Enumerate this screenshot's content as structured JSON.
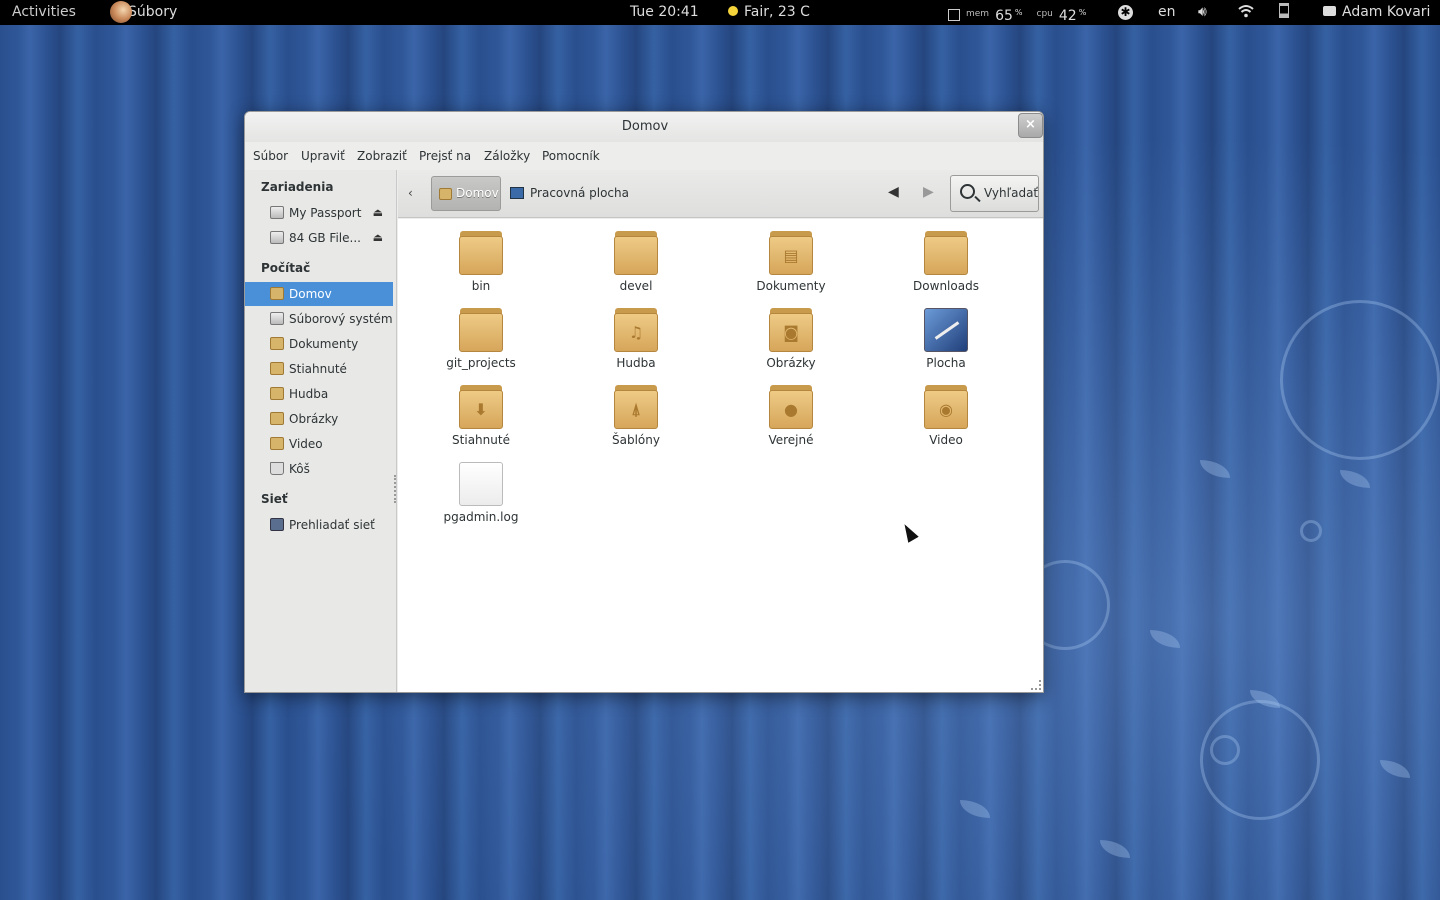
{
  "topbar": {
    "activities": "Activities",
    "app_menu": "Súbory",
    "clock": "Tue 20:41",
    "weather": "Fair, 23 C",
    "mem_label": "mem",
    "mem_value": "65",
    "cpu_label": "cpu",
    "cpu_value": "42",
    "percent": "%",
    "language": "en",
    "user": "Adam Kovari"
  },
  "window": {
    "title": "Domov",
    "close": "×",
    "menu": [
      "Súbor",
      "Upraviť",
      "Zobraziť",
      "Prejsť na",
      "Záložky",
      "Pomocník"
    ]
  },
  "sidebar": {
    "sections": [
      "Zariadenia",
      "Počítač",
      "Sieť"
    ],
    "devices": [
      {
        "label": "My Passport",
        "icon": "drive-icon"
      },
      {
        "label": "84 GB File...",
        "icon": "drive-icon"
      }
    ],
    "computer": [
      {
        "label": "Domov",
        "icon": "home-folder-icon",
        "selected": true
      },
      {
        "label": "Súborový systém",
        "icon": "drive-icon"
      },
      {
        "label": "Dokumenty",
        "icon": "folder-icon"
      },
      {
        "label": "Stiahnuté",
        "icon": "download-folder-icon"
      },
      {
        "label": "Hudba",
        "icon": "music-folder-icon"
      },
      {
        "label": "Obrázky",
        "icon": "pictures-folder-icon"
      },
      {
        "label": "Video",
        "icon": "video-folder-icon"
      },
      {
        "label": "Kôš",
        "icon": "trash-icon"
      }
    ],
    "network": [
      {
        "label": "Prehliadať sieť",
        "icon": "network-icon"
      }
    ]
  },
  "pathbar": {
    "home": "Domov",
    "desktop": "Pracovná plocha",
    "search": "Vyhľadať"
  },
  "files": [
    {
      "name": "bin",
      "icon": "folder-icon",
      "glyph": ""
    },
    {
      "name": "devel",
      "icon": "folder-icon",
      "glyph": ""
    },
    {
      "name": "Dokumenty",
      "icon": "documents-folder-icon",
      "glyph": "▤"
    },
    {
      "name": "Downloads",
      "icon": "folder-icon",
      "glyph": ""
    },
    {
      "name": "git_projects",
      "icon": "folder-icon",
      "glyph": ""
    },
    {
      "name": "Hudba",
      "icon": "music-folder-icon",
      "glyph": "♫"
    },
    {
      "name": "Obrázky",
      "icon": "pictures-folder-icon",
      "glyph": "◙"
    },
    {
      "name": "Plocha",
      "icon": "desktop-icon",
      "glyph": ""
    },
    {
      "name": "Stiahnuté",
      "icon": "download-folder-icon",
      "glyph": "⬇"
    },
    {
      "name": "Šablóny",
      "icon": "templates-folder-icon",
      "glyph": "⍋"
    },
    {
      "name": "Verejné",
      "icon": "public-folder-icon",
      "glyph": "●"
    },
    {
      "name": "Video",
      "icon": "video-folder-icon",
      "glyph": "◉"
    },
    {
      "name": "pgadmin.log",
      "icon": "text-file-icon",
      "glyph": ""
    }
  ],
  "colors": {
    "selection": "#4a90d9",
    "folder": "#e3b56b",
    "desktop_bg": "#2f5798"
  }
}
